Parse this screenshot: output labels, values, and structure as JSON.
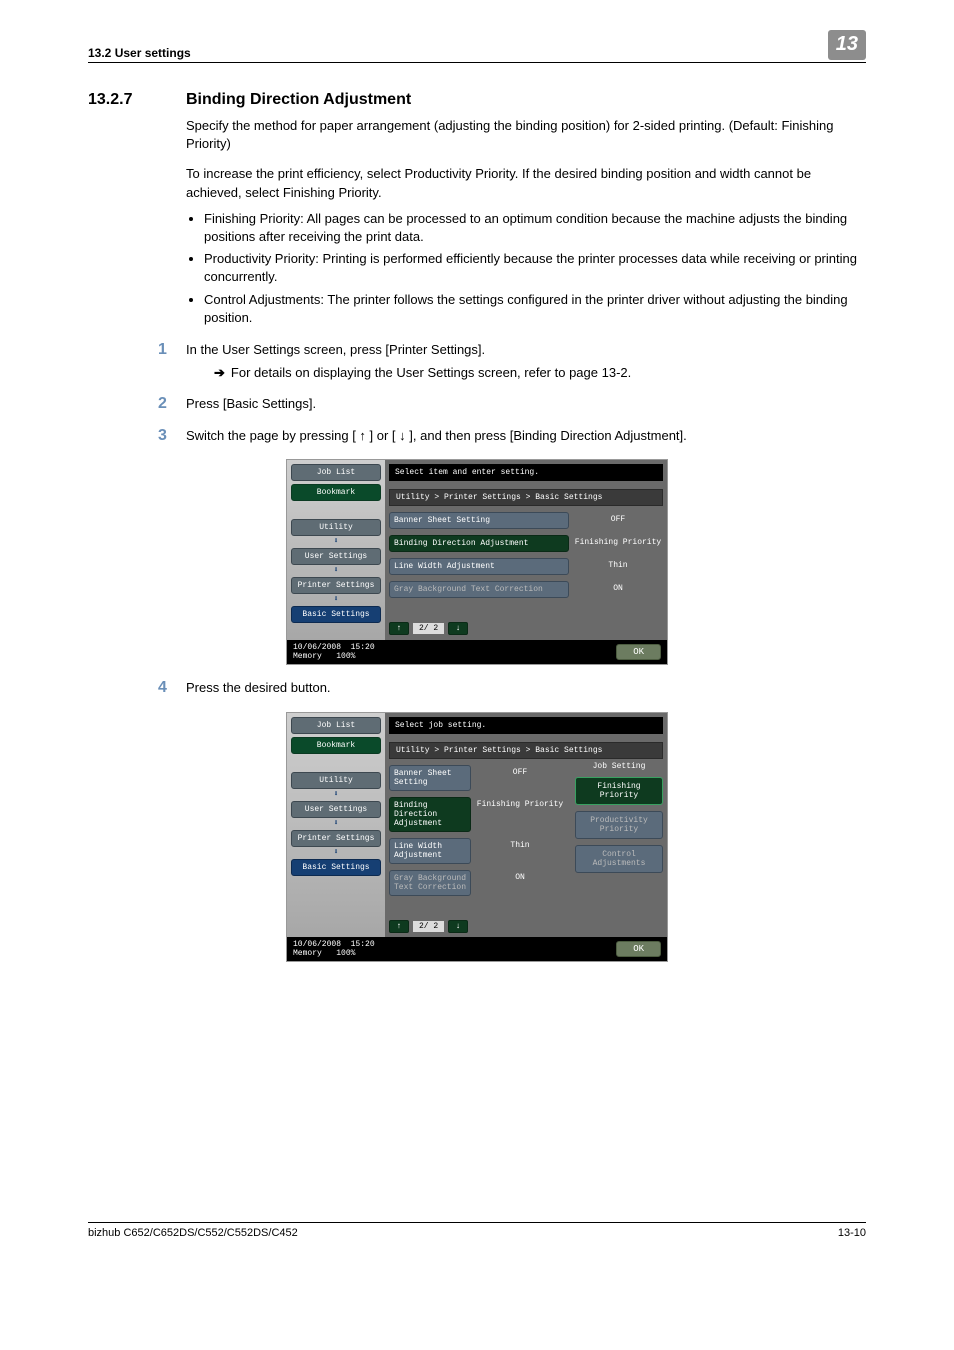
{
  "header": {
    "left": "13.2    User settings",
    "chapter": "13"
  },
  "section": {
    "number": "13.2.7",
    "title": "Binding Direction Adjustment"
  },
  "intro1": "Specify the method for paper arrangement (adjusting the binding position) for 2-sided printing. (Default: Finishing Priority)",
  "intro2": "To increase the print efficiency, select Productivity Priority. If the desired binding position and width cannot be achieved, select Finishing Priority.",
  "bullets": {
    "b1": "Finishing Priority: All pages can be processed to an optimum condition because the machine adjusts the binding positions after receiving the print data.",
    "b2": "Productivity Priority: Printing is performed efficiently because the printer processes data while receiving or printing concurrently.",
    "b3": "Control Adjustments: The printer follows the settings configured in the printer driver without adjusting the binding position."
  },
  "steps": {
    "s1": "In the User Settings screen, press [Printer Settings].",
    "s1sub": "For details on displaying the User Settings screen, refer to page 13-2.",
    "s2": "Press [Basic Settings].",
    "s3": "Switch the page by pressing [ ↑ ] or [ ↓ ], and then press [Binding Direction Adjustment].",
    "s4": "Press the desired button."
  },
  "screen": {
    "left": {
      "job_list": "Job List",
      "bookmark": "Bookmark",
      "utility": "Utility",
      "user_settings": "User Settings",
      "printer_settings": "Printer Settings",
      "basic_settings": "Basic Settings"
    },
    "top1": "Select item and enter setting.",
    "top2": "Select job setting.",
    "breadcrumb": "Utility > Printer Settings > Basic Settings",
    "rows": {
      "r1l": "Banner Sheet Setting",
      "r1v": "OFF",
      "r2l": "Binding Direction Adjustment",
      "r2v": "Finishing Priority",
      "r3l": "Line Width Adjustment",
      "r3v": "Thin",
      "r4l": "Gray Background Text Correction",
      "r4v": "ON"
    },
    "pager": {
      "up": "↑",
      "label": "2/ 2",
      "down": "↓"
    },
    "ok": "OK",
    "status": {
      "date": "10/06/2008",
      "time": "15:20",
      "mem": "Memory",
      "memv": "100%"
    },
    "jobset": {
      "title": "Job Setting",
      "o1": "Finishing Priority",
      "o2": "Productivity Priority",
      "o3": "Control Adjustments"
    }
  },
  "footer": {
    "left": "bizhub C652/C652DS/C552/C552DS/C452",
    "right": "13-10"
  }
}
